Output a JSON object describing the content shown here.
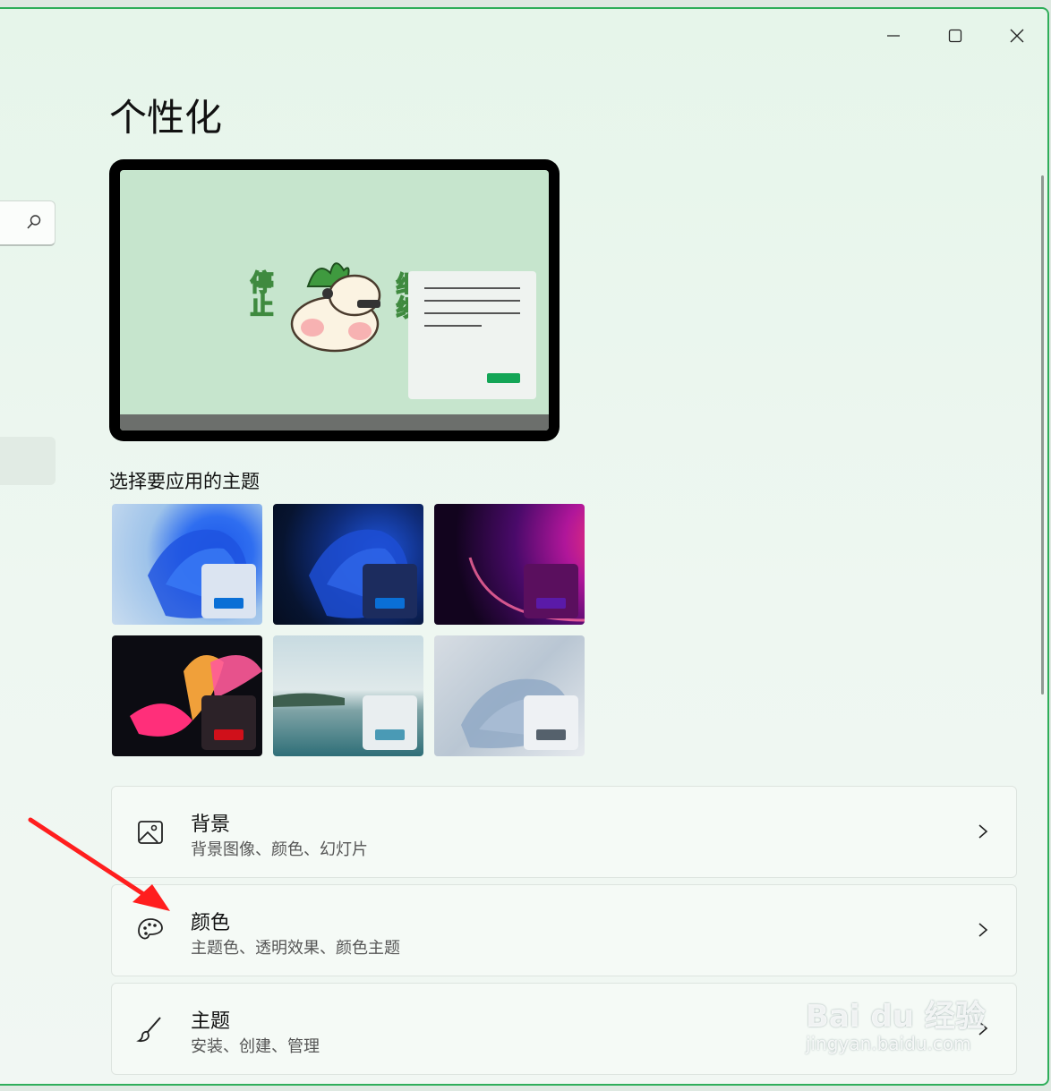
{
  "window": {
    "caption_buttons": [
      "minimize-icon",
      "maximize-icon",
      "close-icon"
    ]
  },
  "page": {
    "title": "个性化"
  },
  "sidebar": {
    "search_icon": "search-icon"
  },
  "preview": {
    "sticker_left": "停止",
    "sticker_right": "继续"
  },
  "themes": {
    "label": "选择要应用的主题",
    "items": [
      {
        "name": "windows-light",
        "accent": "#0a6fd6"
      },
      {
        "name": "windows-dark",
        "accent": "#0a6fd6"
      },
      {
        "name": "glow",
        "accent": "#5a1aa8"
      },
      {
        "name": "captured-motion",
        "accent": "#d0101a"
      },
      {
        "name": "sunrise",
        "accent": "#4a9ab5"
      },
      {
        "name": "flow",
        "accent": "#55616c"
      }
    ]
  },
  "settings": [
    {
      "title": "背景",
      "subtitle": "背景图像、颜色、幻灯片",
      "icon": "image-icon"
    },
    {
      "title": "颜色",
      "subtitle": "主题色、透明效果、颜色主题",
      "icon": "palette-icon"
    },
    {
      "title": "主题",
      "subtitle": "安装、创建、管理",
      "icon": "brush-icon"
    }
  ],
  "watermark": {
    "line1": "Bai du 经验",
    "line2": "jingyan.baidu.com"
  },
  "annotation": {
    "arrow_color": "#ff1e1e"
  }
}
